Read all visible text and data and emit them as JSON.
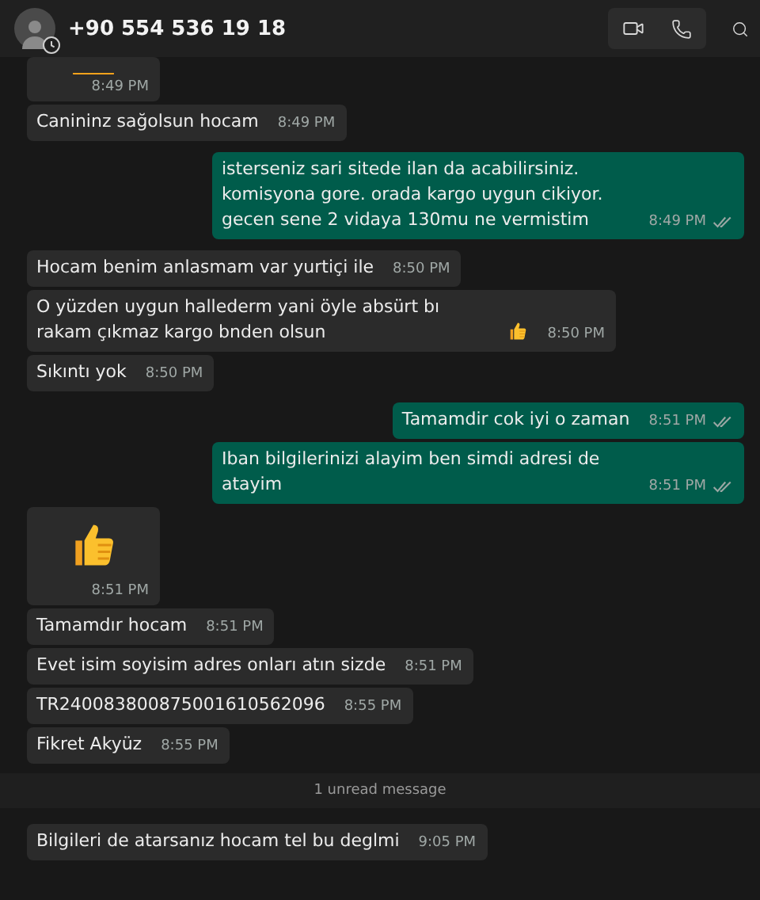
{
  "header": {
    "title": "+90 554 536 19 18"
  },
  "messages": [
    {
      "kind": "partial_emoji",
      "time": "8:49 PM"
    },
    {
      "kind": "incoming",
      "text": "Canininz sağolsun hocam",
      "time": "8:49 PM"
    },
    {
      "kind": "outgoing",
      "text": "isterseniz sari sitede ilan da acabilirsiniz. komisyona gore. orada kargo uygun cikiyor. gecen sene 2 vidaya 130mu ne vermistim",
      "time": "8:49 PM"
    },
    {
      "kind": "incoming",
      "text": "Hocam benim anlasmam var yurtiçi ile",
      "time": "8:50 PM"
    },
    {
      "kind": "incoming_with_emoji",
      "text": "O yüzden uygun hallederm yani öyle absürt bı rakam çıkmaz kargo bnden olsun",
      "time": "8:50 PM"
    },
    {
      "kind": "incoming",
      "text": "Sıkıntı yok",
      "time": "8:50 PM"
    },
    {
      "kind": "outgoing",
      "text": "Tamamdir cok iyi o zaman",
      "time": "8:51 PM"
    },
    {
      "kind": "outgoing",
      "text": "Iban bilgilerinizi alayim ben simdi adresi de atayim",
      "time": "8:51 PM"
    },
    {
      "kind": "emoji",
      "time": "8:51 PM"
    },
    {
      "kind": "incoming",
      "text": "Tamamdır hocam",
      "time": "8:51 PM"
    },
    {
      "kind": "incoming",
      "text": "Evet isim soyisim adres onları atın sizde",
      "time": "8:51 PM"
    },
    {
      "kind": "incoming",
      "text": "TR240083800875001610562096",
      "time": "8:55 PM"
    },
    {
      "kind": "incoming",
      "text": "Fikret Akyüz",
      "time": "8:55 PM"
    },
    {
      "kind": "divider",
      "text": "1 unread message"
    },
    {
      "kind": "incoming",
      "text": "Bilgileri de atarsanız hocam tel bu deglmi",
      "time": "9:05 PM"
    }
  ]
}
